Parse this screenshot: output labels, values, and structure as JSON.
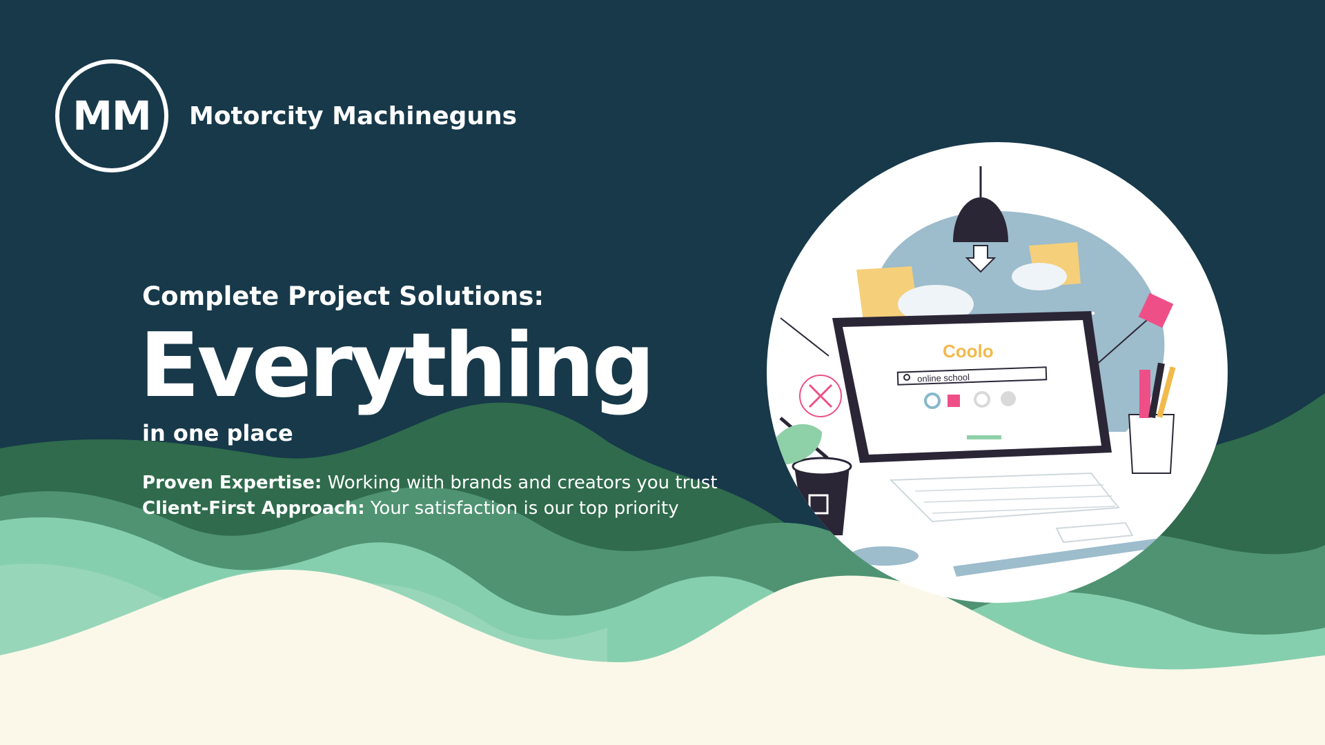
{
  "brand": {
    "logo_text": "MM",
    "name": "Motorcity Machineguns"
  },
  "headline": {
    "kicker": "Complete Project Solutions:",
    "hero": "Everything",
    "sub": "in one place"
  },
  "points": [
    {
      "label": "Proven Expertise:",
      "text": " Working with brands and creators you trust"
    },
    {
      "label": "Client-First Approach:",
      "text": " Your satisfaction is our top priority"
    }
  ],
  "illustration": {
    "search_text": "online school",
    "logo_text": "Coolo"
  },
  "colors": {
    "navy": "#17394a",
    "dark_green": "#2f6b4c",
    "mid_green": "#4f9372",
    "mint": "#86cfae",
    "cream": "#fbf8ea"
  }
}
